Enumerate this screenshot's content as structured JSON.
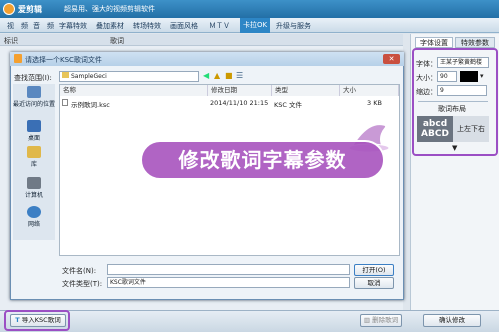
{
  "app": {
    "name": "爱剪辑",
    "slogan": "超易用、强大的视频剪辑软件"
  },
  "menu": [
    "视　频",
    "音　频",
    "字幕特效",
    "叠加素材",
    "转场特效",
    "画面风格",
    "ＭＴＶ",
    "卡拉OK",
    "升级与服务"
  ],
  "subheader": {
    "col1": "标识",
    "col2": "歌词"
  },
  "right": {
    "tab1": "字体设置",
    "tab2": "特效参数",
    "font_label": "字体：",
    "font_value": "王某子繁黄鹤楼",
    "size_label": "大小：",
    "size_value": "90",
    "indent_label": "缩边：",
    "indent_value": "9",
    "layout_label": "歌词布局",
    "preview": "abcd ABCD",
    "layout_option": "上左下右"
  },
  "dialog": {
    "title": "请选择一个KSC歌词文件",
    "lookin_label": "查找范围(I):",
    "lookin_value": "SampleGeci",
    "sidebar": [
      "最近访问的位置",
      "桌面",
      "库",
      "计算机",
      "网络"
    ],
    "columns": [
      "名称",
      "修改日期",
      "类型",
      "大小"
    ],
    "file": {
      "name": "示例歌词.ksc",
      "date": "2014/11/10 21:15",
      "type": "KSC 文件",
      "size": "3 KB"
    },
    "filename_label": "文件名(N):",
    "filename_value": "",
    "filetype_label": "文件类型(T):",
    "filetype_value": "KSC歌词文件",
    "open": "打开(O)",
    "cancel": "取消"
  },
  "banner": "修改歌词字幕参数",
  "bottom": {
    "import": "导入KSC歌词",
    "delete": "删除歌词",
    "confirm": "确认修改"
  },
  "colors": {
    "accent": "#2d86c6",
    "banner": "#a54ebc"
  }
}
